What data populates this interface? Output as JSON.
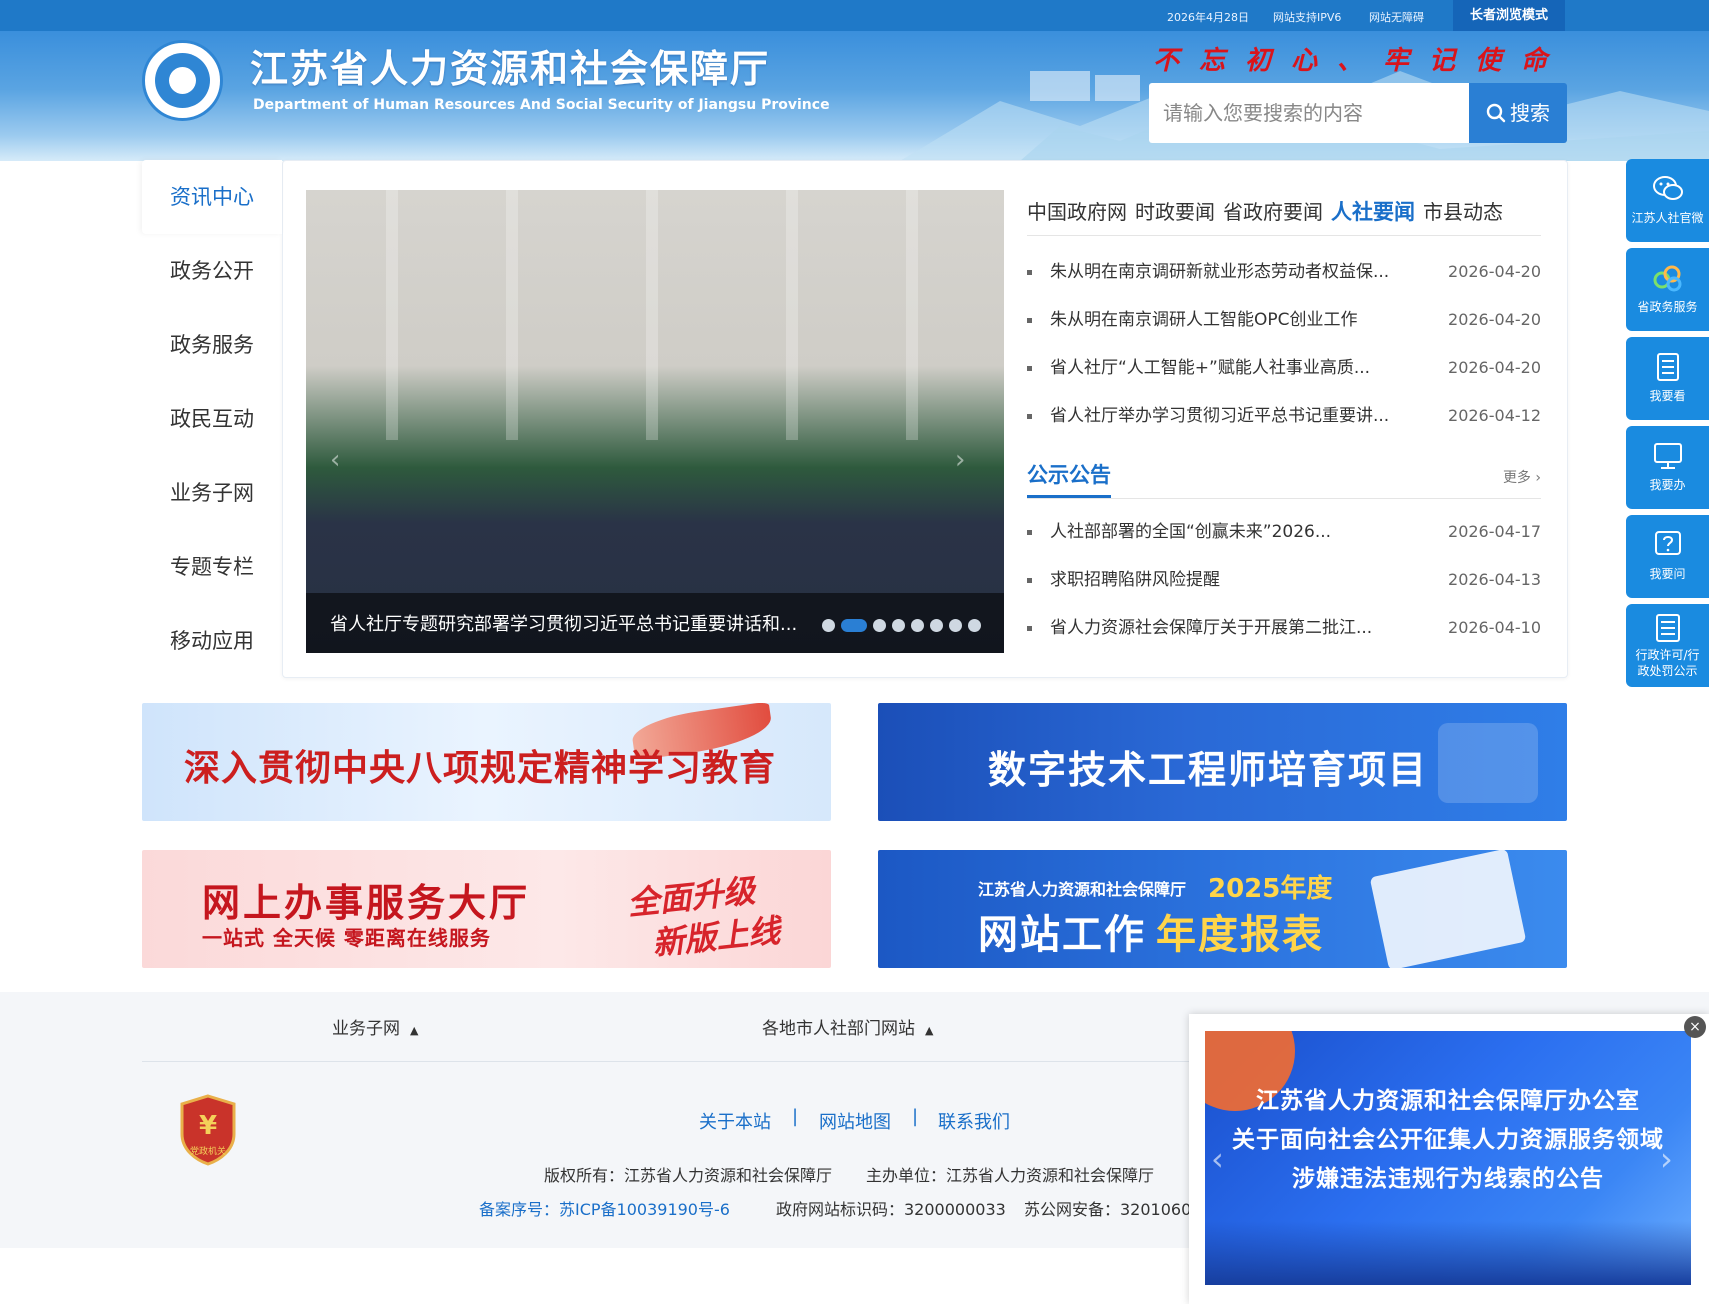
{
  "topbar": {
    "date": "2026年4月28日",
    "ipv6": "网站支持IPV6",
    "accessibility": "网站无障碍",
    "elder_mode": "长者浏览模式"
  },
  "header": {
    "title": "江苏省人力资源和社会保障厅",
    "subtitle": "Department of Human Resources And Social Security of Jiangsu Province",
    "slogan": "不忘初心、牢记使命",
    "search_placeholder": "请输入您要搜索的内容",
    "search_button": "搜索"
  },
  "side_nav": {
    "items": [
      {
        "label": "资讯中心",
        "active": true
      },
      {
        "label": "政务公开"
      },
      {
        "label": "政务服务"
      },
      {
        "label": "政民互动"
      },
      {
        "label": "业务子网"
      },
      {
        "label": "专题专栏"
      },
      {
        "label": "移动应用"
      }
    ]
  },
  "carousel": {
    "caption": "省人社厅专题研究部署学习贯彻习近平总书记重要讲话和...",
    "slide_count": 8,
    "active_index": 1
  },
  "news": {
    "tabs": [
      {
        "label": "中国政府网"
      },
      {
        "label": "时政要闻"
      },
      {
        "label": "省政府要闻"
      },
      {
        "label": "人社要闻",
        "active": true
      },
      {
        "label": "市县动态"
      }
    ],
    "items": [
      {
        "title": "朱从明在南京调研新就业形态劳动者权益保...",
        "date": "2026-04-20"
      },
      {
        "title": "朱从明在南京调研人工智能OPC创业工作",
        "date": "2026-04-20"
      },
      {
        "title": "省人社厅“人工智能+”赋能人社事业高质...",
        "date": "2026-04-20"
      },
      {
        "title": "省人社厅举办学习贯彻习近平总书记重要讲...",
        "date": "2026-04-12"
      }
    ]
  },
  "notices": {
    "title": "公示公告",
    "more": "更多",
    "items": [
      {
        "title": "人社部部署的全国“创赢未来”2026...",
        "date": "2026-04-17"
      },
      {
        "title": "求职招聘陷阱风险提醒",
        "date": "2026-04-13"
      },
      {
        "title": "省人力资源社会保障厅关于开展第二批江...",
        "date": "2026-04-10"
      }
    ]
  },
  "banners": {
    "b1": "深入贯彻中央八项规定精神学习教育",
    "b2": "数字技术工程师培育项目",
    "b3_main": "网上办事服务大厅",
    "b3_sub": "一站式 全天候 零距离在线服务",
    "b3_tag1": "全面升级",
    "b3_tag2": "新版上线",
    "b4_pre": "江苏省人力资源和社会保障厅",
    "b4_year": "2025年度",
    "b4_main": "网站工作",
    "b4_main2": "年度报表"
  },
  "footer": {
    "dropdown1": "业务子网",
    "dropdown2": "各地市人社部门网站",
    "nav": [
      "关于本站",
      "网站地图",
      "联系我们"
    ],
    "sep": "|",
    "badge": "党政机关",
    "copyright": "版权所有：江苏省人力资源和社会保障厅",
    "sponsor": "主办单位：江苏省人力资源和社会保障厅",
    "icp": "备案序号：苏ICP备10039190号-6",
    "gov_id": "政府网站标识码：3200000033",
    "police": "苏公网安备：3201060"
  },
  "float_bar": [
    {
      "label": "江苏人社官微",
      "icon": "wechat-icon"
    },
    {
      "label": "省政务服务",
      "icon": "service-logo-icon"
    },
    {
      "label": "我要看",
      "icon": "document-icon"
    },
    {
      "label": "我要办",
      "icon": "monitor-icon"
    },
    {
      "label": "我要问",
      "icon": "question-icon"
    },
    {
      "label": "行政许可/行政处罚公示",
      "line1": "行政许可/行",
      "line2": "政处罚公示",
      "icon": "list-icon"
    }
  ],
  "popup": {
    "line1": "江苏省人力资源和社会保障厅办公室",
    "line2": "关于面向社会公开征集人力资源服务领域",
    "line3": "涉嫌违法违规行为线索的公告",
    "close": "×"
  },
  "colors": {
    "brand_blue": "#1a6fc9",
    "header_blue": "#3a8fdc",
    "slogan_red": "#d9141b",
    "float_blue": "#1a8be0"
  }
}
